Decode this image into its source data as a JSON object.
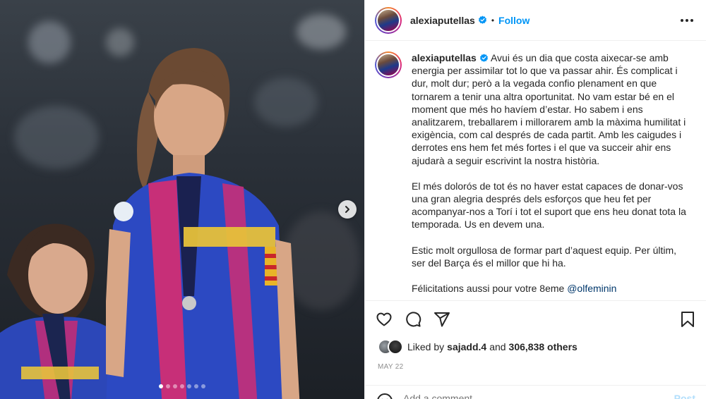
{
  "post": {
    "username": "alexiaputellas",
    "follow_label": "Follow",
    "separator": "•",
    "caption_paragraphs": [
      "Avui és un dia que costa aixecar-se amb energia per assimilar tot lo que va passar ahir. És complicat i dur, molt dur; però a la vegada confio plenament en que tornarem a tenir una altra oportunitat. No vam estar bé en el moment que més ho havíem d’estar. Ho sabem i ens analitzarem, treballarem i millorarem amb la màxima humilitat i exigència, com cal després de cada partit. Amb les caigudes i derrotes ens hem fet més fortes i el que va succeir ahir ens ajudarà a seguir escrivint la nostra història.",
      "El més dolorós de tot és no haver estat capaces de donar-vos una gran alegria després dels esforços que heu fet per acompanyar-nos a Torí i tot el suport que ens heu donat tota la temporada. Us en devem una.",
      "Estic molt orgullosa de formar part d’aquest equip. Per últim, ser del Barça és el millor que hi ha."
    ],
    "last_line_text": "Félicitations aussi pour votre 8eme",
    "mention": "@olfeminin",
    "likes": {
      "prefix": "Liked by",
      "user": "sajadd.4",
      "conjunction": "and",
      "others": "306,838 others"
    },
    "date": "MAY 22",
    "comment_placeholder": "Add a comment...",
    "post_button": "Post"
  },
  "carousel": {
    "total_slides": 7,
    "active_index": 0
  },
  "colors": {
    "accent": "#0095f6",
    "verified": "#0095f6",
    "mention": "#00376b",
    "date": "#8e8e8e"
  },
  "icons": {
    "verified": "verified-badge-icon",
    "more": "more-options-icon",
    "like": "heart-icon",
    "comment": "comment-icon",
    "share": "share-icon",
    "save": "bookmark-icon",
    "next": "chevron-right-icon",
    "emoji": "emoji-icon"
  }
}
